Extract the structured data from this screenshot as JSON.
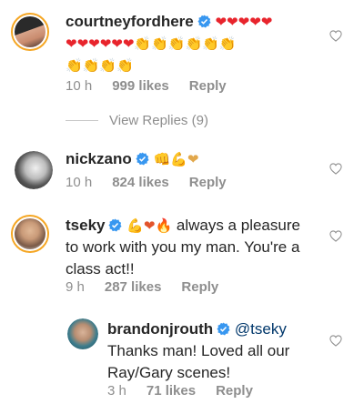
{
  "comments": [
    {
      "username": "courtneyfordhere",
      "text_line1": "❤❤❤❤❤",
      "text_line2": "❤❤❤❤❤❤👏👏👏👏👏👏",
      "text_line3": "👏👏👏👏",
      "time": "10 h",
      "likes": "999 likes",
      "reply": "Reply",
      "view_replies": "View Replies (9)"
    },
    {
      "username": "nickzano",
      "text_line1": "👊💪❤",
      "time": "10 h",
      "likes": "824 likes",
      "reply": "Reply"
    },
    {
      "username": "tseky",
      "emoji": "💪❤🔥",
      "text_line1": "always a pleasure",
      "text_line2": "to work with you my man.  You're a",
      "text_line3": "class act!!",
      "time": "9 h",
      "likes": "287 likes",
      "reply": "Reply"
    },
    {
      "username": "brandonjrouth",
      "mention": "@tseky",
      "text_line1": "Thanks man! Loved all our",
      "text_line2": "Ray/Gary scenes!",
      "time": "3 h",
      "likes": "71 likes",
      "reply": "Reply"
    }
  ],
  "colors": {
    "heart": "#e8242c",
    "verified": "#3897f0",
    "meta": "#8e8e8e",
    "mention": "#00376b"
  }
}
